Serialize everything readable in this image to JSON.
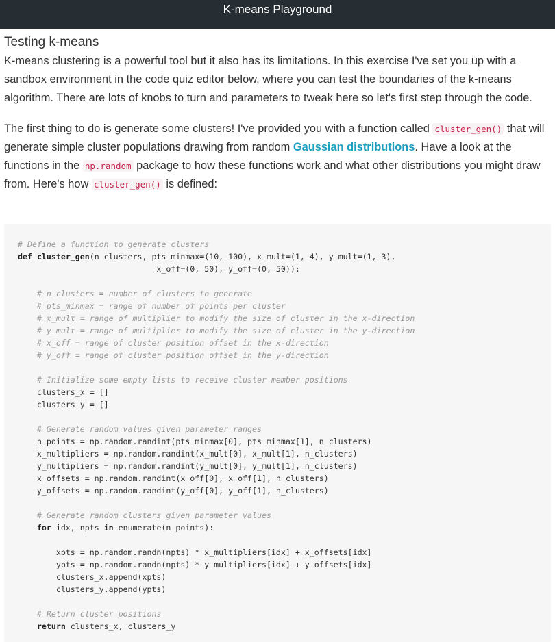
{
  "topbar": {
    "title": "K-means Playground"
  },
  "section": {
    "heading": "Testing k-means",
    "para1": "K-means clustering is a powerful tool but it also has its limitations. In this exercise I've set you up with a sandbox environment in the code quiz editor below, where you can test the boundaries of the k-means algorithm. There are lots of knobs to turn and parameters to tweak here so let's first step through the code.",
    "para2": {
      "t1": "The first thing to do is generate some clusters! I've provided you with a function called ",
      "code1": "cluster_gen()",
      "t2": " that will generate simple cluster populations drawing from random ",
      "link": "Gaussian distributions",
      "t3": ". Have a look at the functions in the ",
      "code2": "np.random",
      "t4": " package to how these functions work and what other distributions you might draw from. Here's how ",
      "code3": "cluster_gen()",
      "t5": " is defined:"
    }
  },
  "code": {
    "l01": "# Define a function to generate clusters",
    "l02_kw": "def",
    "l02_fn": "cluster_gen",
    "l02_rest": "(n_clusters, pts_minmax=(10, 100), x_mult=(1, 4), y_mult=(1, 3),",
    "l03": "                             x_off=(0, 50), y_off=(0, 50)):",
    "l05": "    # n_clusters = number of clusters to generate",
    "l06": "    # pts_minmax = range of number of points per cluster",
    "l07": "    # x_mult = range of multiplier to modify the size of cluster in the x-direction",
    "l08": "    # y_mult = range of multiplier to modify the size of cluster in the y-direction",
    "l09": "    # x_off = range of cluster position offset in the x-direction",
    "l10": "    # y_off = range of cluster position offset in the y-direction",
    "l12": "    # Initialize some empty lists to receive cluster member positions",
    "l13": "    clusters_x = []",
    "l14": "    clusters_y = []",
    "l16": "    # Generate random values given parameter ranges",
    "l17": "    n_points = np.random.randint(pts_minmax[0], pts_minmax[1], n_clusters)",
    "l18": "    x_multipliers = np.random.randint(x_mult[0], x_mult[1], n_clusters)",
    "l19": "    y_multipliers = np.random.randint(y_mult[0], y_mult[1], n_clusters)",
    "l20": "    x_offsets = np.random.randint(x_off[0], x_off[1], n_clusters)",
    "l21": "    y_offsets = np.random.randint(y_off[0], y_off[1], n_clusters)",
    "l23": "    # Generate random clusters given parameter values",
    "l24_kw1": "for",
    "l24_a": " idx, npts ",
    "l24_kw2": "in",
    "l24_b": " enumerate(n_points):",
    "l26": "        xpts = np.random.randn(npts) * x_multipliers[idx] + x_offsets[idx]",
    "l27": "        ypts = np.random.randn(npts) * y_multipliers[idx] + y_offsets[idx]",
    "l28": "        clusters_x.append(xpts)",
    "l29": "        clusters_y.append(ypts)",
    "l31": "    # Return cluster positions",
    "l32_kw": "return",
    "l32_rest": " clusters_x, clusters_y"
  }
}
